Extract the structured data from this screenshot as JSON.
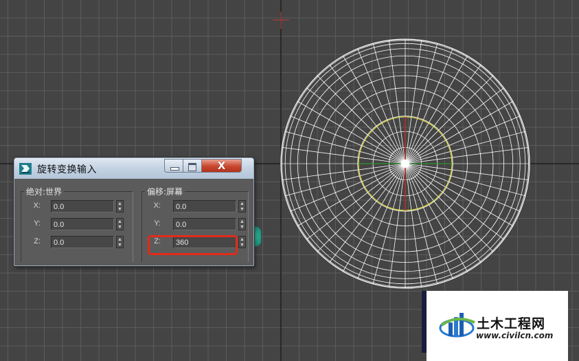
{
  "dialog": {
    "title": "旋转变换输入",
    "close_label": "X",
    "absolute_group": {
      "label": "绝对:世界",
      "fields": [
        {
          "axis": "X:",
          "value": "0.0"
        },
        {
          "axis": "Y:",
          "value": "0.0"
        },
        {
          "axis": "Z:",
          "value": "0.0"
        }
      ]
    },
    "offset_group": {
      "label": "偏移:屏幕",
      "fields": [
        {
          "axis": "X:",
          "value": "0.0"
        },
        {
          "axis": "Y:",
          "value": "0.0"
        },
        {
          "axis": "Z:",
          "value": "360"
        }
      ]
    }
  },
  "watermark": {
    "name": "土木工程网",
    "url": "www.civilcn.com"
  },
  "colors": {
    "viewport_bg": "#444444",
    "grid_line": "#5c5c5c",
    "grid_major": "#1e1e1e",
    "sphere_wire": "#ffffff",
    "gizmo_ring": "#d8d84a",
    "axis_red": "#b83030",
    "axis_green": "#3aa03a",
    "highlight": "#e32a1a",
    "close_button": "#c8462e"
  }
}
